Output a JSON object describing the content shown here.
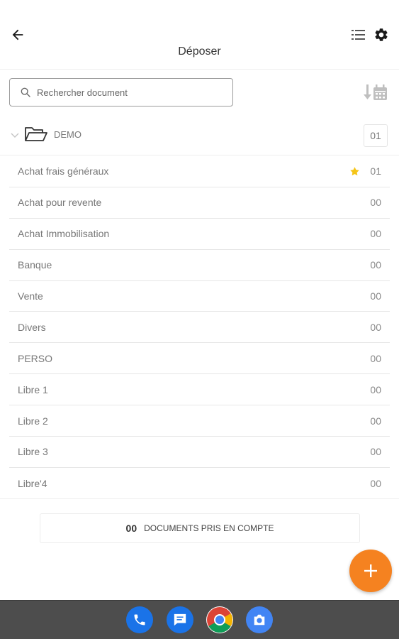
{
  "header": {
    "title": "Déposer"
  },
  "search": {
    "placeholder": "Rechercher document"
  },
  "folder": {
    "name": "DEMO",
    "count": "01"
  },
  "rows": [
    {
      "label": "Achat frais généraux",
      "count": "01",
      "starred": true
    },
    {
      "label": "Achat pour revente",
      "count": "00"
    },
    {
      "label": "Achat Immobilisation",
      "count": "00"
    },
    {
      "label": "Banque",
      "count": "00"
    },
    {
      "label": "Vente",
      "count": "00"
    },
    {
      "label": "Divers",
      "count": "00"
    },
    {
      "label": "PERSO",
      "count": "00"
    },
    {
      "label": "Libre 1",
      "count": "00"
    },
    {
      "label": "Libre 2",
      "count": "00"
    },
    {
      "label": "Libre 3",
      "count": "00"
    },
    {
      "label": "Libre'4",
      "count": "00"
    }
  ],
  "summary": {
    "count": "00",
    "text": "DOCUMENTS PRIS EN COMPTE"
  },
  "icons": {
    "back": "arrow-left-icon",
    "list": "list-icon",
    "settings": "gear-icon",
    "search": "search-icon",
    "sort": "sort-calendar-icon",
    "folder": "folder-open-icon",
    "star": "star-icon",
    "fab": "plus-icon"
  },
  "dock": {
    "apps": [
      "phone-icon",
      "messages-icon",
      "chrome-icon",
      "camera-icon"
    ]
  },
  "colors": {
    "accent": "#f58220",
    "star": "#f5c518",
    "dock_bg": "#4d4d4d",
    "phone": "#1a73e8",
    "messages": "#1a73e8",
    "camera": "#4285f4"
  }
}
